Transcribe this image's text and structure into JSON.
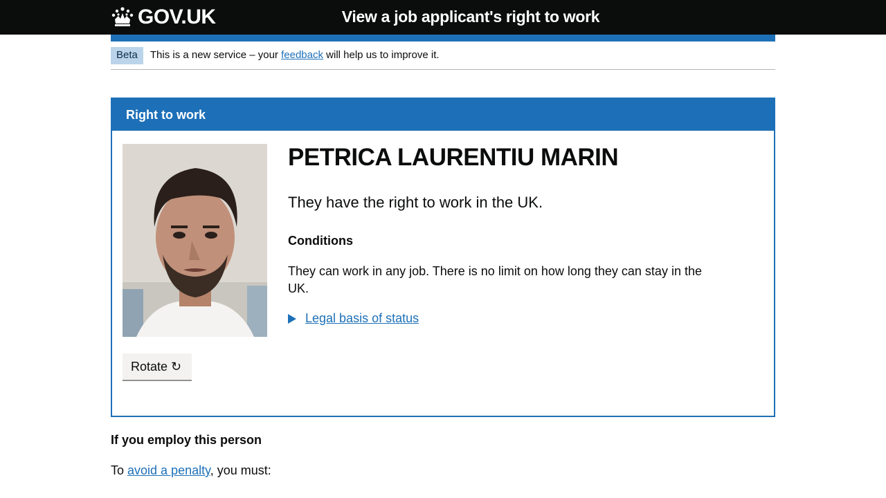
{
  "header": {
    "logo_text": "GOV.UK",
    "service_name": "View a job applicant's right to work"
  },
  "phase_banner": {
    "tag": "Beta",
    "text_before": "This is a new service – your ",
    "link": "feedback",
    "text_after": " will help us to improve it."
  },
  "panel": {
    "title": "Right to work",
    "name": "PETRICA LAURENTIU MARIN",
    "status": "They have the right to work in the UK.",
    "conditions_heading": "Conditions",
    "conditions_text": "They can work in any job. There is no limit on how long they can stay in the UK.",
    "details_link": "Legal basis of status",
    "rotate_label": "Rotate ↻"
  },
  "employ": {
    "heading": "If you employ this person",
    "text_before": "To ",
    "link": "avoid a penalty",
    "text_after": ", you must:"
  },
  "colors": {
    "header_bg": "#0b0c0c",
    "brand_blue": "#1d70b8",
    "beta_tag_bg": "#bbd4ea"
  }
}
